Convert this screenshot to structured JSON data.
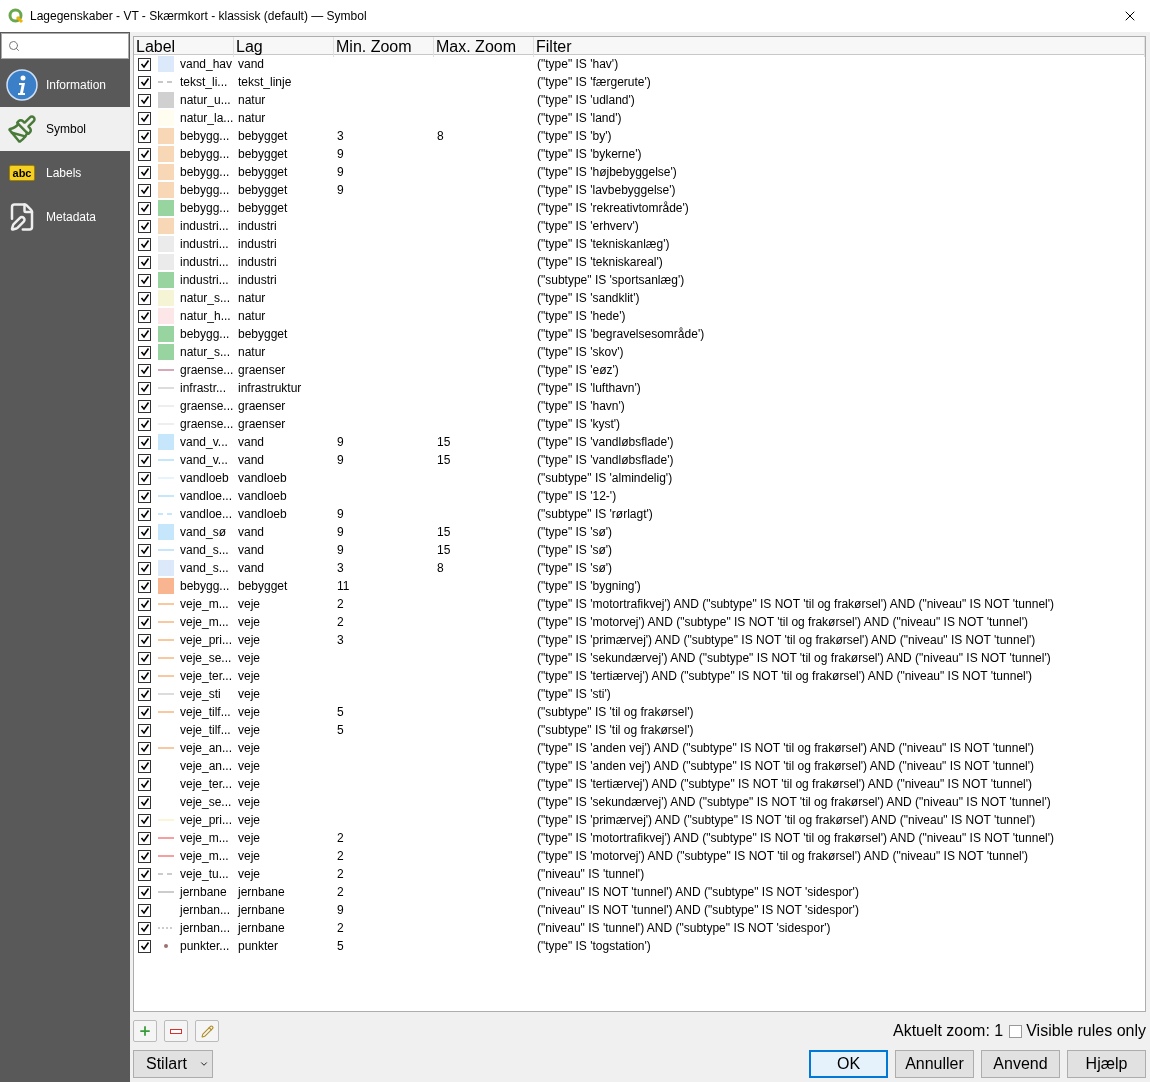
{
  "window": {
    "title": "Lagegenskaber - VT - Skærmkort - klassisk (default) — Symbol"
  },
  "sidebar": {
    "items": [
      {
        "label": "Information",
        "kind": "info",
        "selected": false
      },
      {
        "label": "Symbol",
        "kind": "brush",
        "selected": true
      },
      {
        "label": "Labels",
        "kind": "tag",
        "badge": "abc",
        "selected": false
      },
      {
        "label": "Metadata",
        "kind": "doc",
        "selected": false
      }
    ]
  },
  "table": {
    "columns": [
      "Label",
      "Lag",
      "Min. Zoom",
      "Max. Zoom",
      "Filter"
    ],
    "rows": [
      {
        "checked": true,
        "kind": "fill",
        "color": "#dbe9fb",
        "label": "vand_hav",
        "layer": "vand",
        "min": "",
        "max": "",
        "filter": "(\"type\" IS 'hav')"
      },
      {
        "checked": true,
        "kind": "dash",
        "color": "#c8c8c8",
        "label": "tekst_li...",
        "layer": "tekst_linje",
        "min": "",
        "max": "",
        "filter": "(\"type\" IS 'færgerute')"
      },
      {
        "checked": true,
        "kind": "fill",
        "color": "#d0d0d0",
        "label": "natur_u...",
        "layer": "natur",
        "min": "",
        "max": "",
        "filter": "(\"type\" IS 'udland')"
      },
      {
        "checked": true,
        "kind": "fill",
        "color": "#fffdf0",
        "label": "natur_la...",
        "layer": "natur",
        "min": "",
        "max": "",
        "filter": "(\"type\" IS 'land')"
      },
      {
        "checked": true,
        "kind": "fill",
        "color": "#f8d7b6",
        "label": "bebygg...",
        "layer": "bebygget",
        "min": "3",
        "max": "8",
        "filter": "(\"type\" IS 'by')"
      },
      {
        "checked": true,
        "kind": "fill",
        "color": "#f8d7b6",
        "label": "bebygg...",
        "layer": "bebygget",
        "min": "9",
        "max": "",
        "filter": "(\"type\" IS 'bykerne')"
      },
      {
        "checked": true,
        "kind": "fill",
        "color": "#f8d7b6",
        "label": "bebygg...",
        "layer": "bebygget",
        "min": "9",
        "max": "",
        "filter": "(\"type\" IS 'højbebyggelse')"
      },
      {
        "checked": true,
        "kind": "fill",
        "color": "#f8d7b6",
        "label": "bebygg...",
        "layer": "bebygget",
        "min": "9",
        "max": "",
        "filter": "(\"type\" IS 'lavbebyggelse')"
      },
      {
        "checked": true,
        "kind": "fill",
        "color": "#98d4a0",
        "label": "bebygg...",
        "layer": "bebygget",
        "min": "",
        "max": "",
        "filter": "(\"type\" IS 'rekreativtområde')"
      },
      {
        "checked": true,
        "kind": "fill",
        "color": "#f8d7b6",
        "label": "industri...",
        "layer": "industri",
        "min": "",
        "max": "",
        "filter": "(\"type\" IS 'erhverv')"
      },
      {
        "checked": true,
        "kind": "fill",
        "color": "#ebebeb",
        "label": "industri...",
        "layer": "industri",
        "min": "",
        "max": "",
        "filter": "(\"type\" IS 'tekniskanlæg')"
      },
      {
        "checked": true,
        "kind": "fill",
        "color": "#ebebeb",
        "label": "industri...",
        "layer": "industri",
        "min": "",
        "max": "",
        "filter": "(\"type\" IS 'tekniskareal')"
      },
      {
        "checked": true,
        "kind": "fill",
        "color": "#98d4a0",
        "label": "industri...",
        "layer": "industri",
        "min": "",
        "max": "",
        "filter": "(\"subtype\" IS 'sportsanlæg')"
      },
      {
        "checked": true,
        "kind": "fill",
        "color": "#f5f5d6",
        "label": "natur_s...",
        "layer": "natur",
        "min": "",
        "max": "",
        "filter": "(\"type\" IS 'sandklit')"
      },
      {
        "checked": true,
        "kind": "fill",
        "color": "#fde6e8",
        "label": "natur_h...",
        "layer": "natur",
        "min": "",
        "max": "",
        "filter": "(\"type\" IS 'hede')"
      },
      {
        "checked": true,
        "kind": "fill",
        "color": "#98d4a0",
        "label": "bebygg...",
        "layer": "bebygget",
        "min": "",
        "max": "",
        "filter": "(\"type\" IS 'begravelsesområde')"
      },
      {
        "checked": true,
        "kind": "fill",
        "color": "#98d4a0",
        "label": "natur_s...",
        "layer": "natur",
        "min": "",
        "max": "",
        "filter": "(\"type\" IS 'skov')"
      },
      {
        "checked": true,
        "kind": "line",
        "color": "#d8a8b8",
        "label": "graense...",
        "layer": "graenser",
        "min": "",
        "max": "",
        "filter": "(\"type\" IS 'eøz')"
      },
      {
        "checked": true,
        "kind": "line",
        "color": "#dcdcdc",
        "label": "infrastr...",
        "layer": "infrastruktur",
        "min": "",
        "max": "",
        "filter": "(\"type\" IS 'lufthavn')"
      },
      {
        "checked": true,
        "kind": "line",
        "color": "#eeeeee",
        "label": "graense...",
        "layer": "graenser",
        "min": "",
        "max": "",
        "filter": "(\"type\" IS 'havn')"
      },
      {
        "checked": true,
        "kind": "line",
        "color": "#eeeeee",
        "label": "graense...",
        "layer": "graenser",
        "min": "",
        "max": "",
        "filter": "(\"type\" IS 'kyst')"
      },
      {
        "checked": true,
        "kind": "fill",
        "color": "#c6e6fb",
        "label": "vand_v...",
        "layer": "vand",
        "min": "9",
        "max": "15",
        "filter": "(\"type\" IS 'vandløbsflade')"
      },
      {
        "checked": true,
        "kind": "line",
        "color": "#c6e6fb",
        "label": "vand_v...",
        "layer": "vand",
        "min": "9",
        "max": "15",
        "filter": "(\"type\" IS 'vandløbsflade')"
      },
      {
        "checked": true,
        "kind": "line",
        "color": "#e8f4fb",
        "label": "vandloeb",
        "layer": "vandloeb",
        "min": "",
        "max": "",
        "filter": "(\"subtype\" IS 'almindelig')"
      },
      {
        "checked": true,
        "kind": "line",
        "color": "#c6e6fb",
        "label": "vandloe...",
        "layer": "vandloeb",
        "min": "",
        "max": "",
        "filter": "(\"type\" IS '12-')"
      },
      {
        "checked": true,
        "kind": "dash",
        "color": "#c6e6fb",
        "label": "vandloe...",
        "layer": "vandloeb",
        "min": "9",
        "max": "",
        "filter": "(\"subtype\" IS 'rørlagt')"
      },
      {
        "checked": true,
        "kind": "fill",
        "color": "#c6e6fb",
        "label": "vand_sø",
        "layer": "vand",
        "min": "9",
        "max": "15",
        "filter": "(\"type\" IS 'sø')"
      },
      {
        "checked": true,
        "kind": "line",
        "color": "#c6e6fb",
        "label": "vand_s...",
        "layer": "vand",
        "min": "9",
        "max": "15",
        "filter": "(\"type\" IS 'sø')"
      },
      {
        "checked": true,
        "kind": "fill",
        "color": "#dbe9fb",
        "label": "vand_s...",
        "layer": "vand",
        "min": "3",
        "max": "8",
        "filter": "(\"type\" IS 'sø')"
      },
      {
        "checked": true,
        "kind": "fill",
        "color": "#f9b490",
        "label": "bebygg...",
        "layer": "bebygget",
        "min": "11",
        "max": "",
        "filter": "(\"type\" IS 'bygning')"
      },
      {
        "checked": true,
        "kind": "line",
        "color": "#f8c9a0",
        "label": "veje_m...",
        "layer": "veje",
        "min": "2",
        "max": "",
        "filter": "(\"type\" IS 'motortrafikvej') AND (\"subtype\" IS NOT 'til og frakørsel') AND (\"niveau\" IS NOT 'tunnel')"
      },
      {
        "checked": true,
        "kind": "line",
        "color": "#f8c9a0",
        "label": "veje_m...",
        "layer": "veje",
        "min": "2",
        "max": "",
        "filter": "(\"type\" IS 'motorvej') AND (\"subtype\" IS NOT 'til og frakørsel') AND (\"niveau\" IS NOT 'tunnel')"
      },
      {
        "checked": true,
        "kind": "line",
        "color": "#f8c9a0",
        "label": "veje_pri...",
        "layer": "veje",
        "min": "3",
        "max": "",
        "filter": "(\"type\" IS 'primærvej') AND (\"subtype\" IS NOT 'til og frakørsel') AND (\"niveau\" IS NOT 'tunnel')"
      },
      {
        "checked": true,
        "kind": "line",
        "color": "#f8c9a0",
        "label": "veje_se...",
        "layer": "veje",
        "min": "",
        "max": "",
        "filter": "(\"type\" IS 'sekundærvej') AND (\"subtype\" IS NOT 'til og frakørsel') AND (\"niveau\" IS NOT 'tunnel')"
      },
      {
        "checked": true,
        "kind": "line",
        "color": "#f8c9a0",
        "label": "veje_ter...",
        "layer": "veje",
        "min": "",
        "max": "",
        "filter": "(\"type\" IS 'tertiærvej') AND (\"subtype\" IS NOT 'til og frakørsel') AND (\"niveau\" IS NOT 'tunnel')"
      },
      {
        "checked": true,
        "kind": "line",
        "color": "#dcdcdc",
        "label": "veje_sti",
        "layer": "veje",
        "min": "",
        "max": "",
        "filter": "(\"type\" IS 'sti')"
      },
      {
        "checked": true,
        "kind": "line",
        "color": "#f8c9a0",
        "label": "veje_tilf...",
        "layer": "veje",
        "min": "5",
        "max": "",
        "filter": "(\"subtype\" IS 'til og frakørsel')"
      },
      {
        "checked": true,
        "kind": "none",
        "label": "veje_tilf...",
        "layer": "veje",
        "min": "5",
        "max": "",
        "filter": "(\"subtype\" IS 'til og frakørsel')"
      },
      {
        "checked": true,
        "kind": "line",
        "color": "#f8c9a0",
        "label": "veje_an...",
        "layer": "veje",
        "min": "",
        "max": "",
        "filter": "(\"type\" IS 'anden vej') AND (\"subtype\" IS NOT 'til og frakørsel') AND (\"niveau\" IS NOT 'tunnel')"
      },
      {
        "checked": true,
        "kind": "none",
        "label": "veje_an...",
        "layer": "veje",
        "min": "",
        "max": "",
        "filter": "(\"type\" IS 'anden vej') AND (\"subtype\" IS NOT 'til og frakørsel') AND (\"niveau\" IS NOT 'tunnel')"
      },
      {
        "checked": true,
        "kind": "none",
        "label": "veje_ter...",
        "layer": "veje",
        "min": "",
        "max": "",
        "filter": "(\"type\" IS 'tertiærvej') AND (\"subtype\" IS NOT 'til og frakørsel') AND (\"niveau\" IS NOT 'tunnel')"
      },
      {
        "checked": true,
        "kind": "none",
        "label": "veje_se...",
        "layer": "veje",
        "min": "",
        "max": "",
        "filter": "(\"type\" IS 'sekundærvej') AND (\"subtype\" IS NOT 'til og frakørsel') AND (\"niveau\" IS NOT 'tunnel')"
      },
      {
        "checked": true,
        "kind": "line",
        "color": "#fbf6d8",
        "label": "veje_pri...",
        "layer": "veje",
        "min": "",
        "max": "",
        "filter": "(\"type\" IS 'primærvej') AND (\"subtype\" IS NOT 'til og frakørsel') AND (\"niveau\" IS NOT 'tunnel')"
      },
      {
        "checked": true,
        "kind": "line",
        "color": "#f5a0a0",
        "label": "veje_m...",
        "layer": "veje",
        "min": "2",
        "max": "",
        "filter": "(\"type\" IS 'motortrafikvej') AND (\"subtype\" IS NOT 'til og frakørsel') AND (\"niveau\" IS NOT 'tunnel')"
      },
      {
        "checked": true,
        "kind": "line",
        "color": "#f5a0a0",
        "label": "veje_m...",
        "layer": "veje",
        "min": "2",
        "max": "",
        "filter": "(\"type\" IS 'motorvej') AND (\"subtype\" IS NOT 'til og frakørsel') AND (\"niveau\" IS NOT 'tunnel')"
      },
      {
        "checked": true,
        "kind": "dash",
        "color": "#cccccc",
        "label": "veje_tu...",
        "layer": "veje",
        "min": "2",
        "max": "",
        "filter": "(\"niveau\" IS 'tunnel')"
      },
      {
        "checked": true,
        "kind": "line",
        "color": "#cccccc",
        "label": "jernbane",
        "layer": "jernbane",
        "min": "2",
        "max": "",
        "filter": "(\"niveau\" IS NOT 'tunnel') AND (\"subtype\" IS NOT 'sidespor')"
      },
      {
        "checked": true,
        "kind": "none",
        "label": "jernban...",
        "layer": "jernbane",
        "min": "9",
        "max": "",
        "filter": "(\"niveau\" IS NOT 'tunnel') AND (\"subtype\" IS NOT 'sidespor')"
      },
      {
        "checked": true,
        "kind": "dot",
        "color": "#cccccc",
        "label": "jernban...",
        "layer": "jernbane",
        "min": "2",
        "max": "",
        "filter": "(\"niveau\" IS 'tunnel') AND (\"subtype\" IS NOT 'sidespor')"
      },
      {
        "checked": true,
        "kind": "point",
        "color": "#a07070",
        "label": "punkter...",
        "layer": "punkter",
        "min": "5",
        "max": "",
        "filter": "(\"type\" IS 'togstation')"
      }
    ]
  },
  "footer": {
    "zoom_label": "Aktuelt zoom: 1",
    "visible_rules_only": {
      "label": "Visible rules only",
      "checked": false
    }
  },
  "style_button": {
    "label": "Stilart"
  },
  "buttons": [
    {
      "label": "OK",
      "default": true
    },
    {
      "label": "Annuller",
      "default": false
    },
    {
      "label": "Anvend",
      "default": false
    },
    {
      "label": "Hjælp",
      "default": false
    }
  ]
}
